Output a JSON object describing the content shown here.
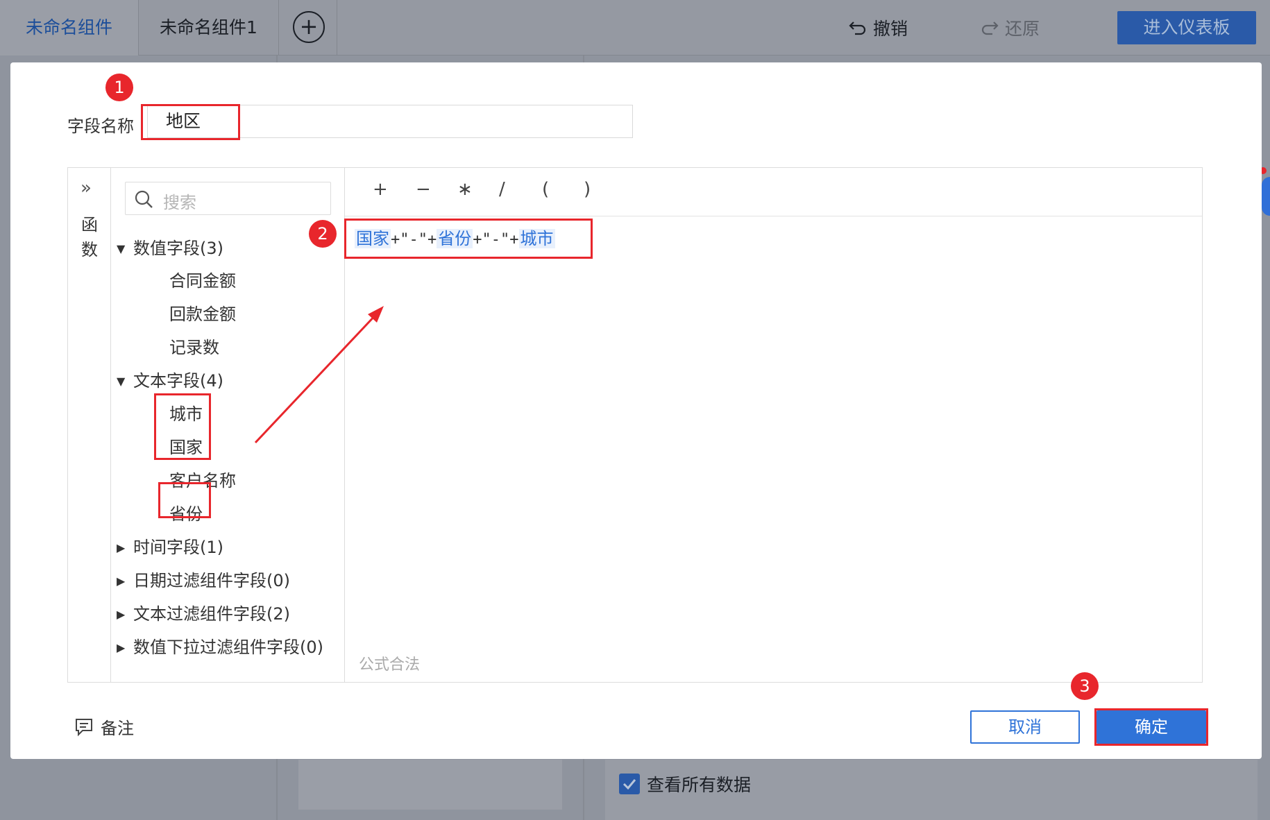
{
  "tabs": [
    {
      "label": "未命名组件"
    },
    {
      "label": "未命名组件1"
    }
  ],
  "toolbar": {
    "undo_label": "撤销",
    "redo_label": "还原",
    "enter_dashboard_label": "进入仪表板"
  },
  "dialog": {
    "field_name_label": "字段名称",
    "field_name_value": "地区",
    "functions_label": "函数",
    "search_placeholder": "搜索",
    "operators": [
      "+",
      "−",
      "∗",
      "/",
      "(",
      ")"
    ],
    "groups": [
      {
        "label": "数值字段(3)",
        "expanded": true,
        "items": [
          "合同金额",
          "回款金额",
          "记录数"
        ]
      },
      {
        "label": "文本字段(4)",
        "expanded": true,
        "items": [
          "城市",
          "国家",
          "客户名称",
          "省份"
        ]
      },
      {
        "label": "时间字段(1)",
        "expanded": false
      },
      {
        "label": "日期过滤组件字段(0)",
        "expanded": false
      },
      {
        "label": "文本过滤组件字段(2)",
        "expanded": false
      },
      {
        "label": "数值下拉过滤组件字段(0)",
        "expanded": false
      }
    ],
    "formula": {
      "tokens": [
        "国家",
        "省份",
        "城市"
      ],
      "separator_literal": "\"-\"",
      "plus": "+"
    },
    "validation_text": "公式合法",
    "note_label": "备注",
    "cancel_label": "取消",
    "confirm_label": "确定"
  },
  "annotations": {
    "badge_1": "1",
    "badge_2": "2",
    "badge_3": "3",
    "accent_color": "#e8262c"
  },
  "background": {
    "view_all_label": "查看所有数据"
  },
  "colors": {
    "primary": "#2f73d8",
    "overlay": "#8f949e",
    "annotation_red": "#e8262c"
  }
}
